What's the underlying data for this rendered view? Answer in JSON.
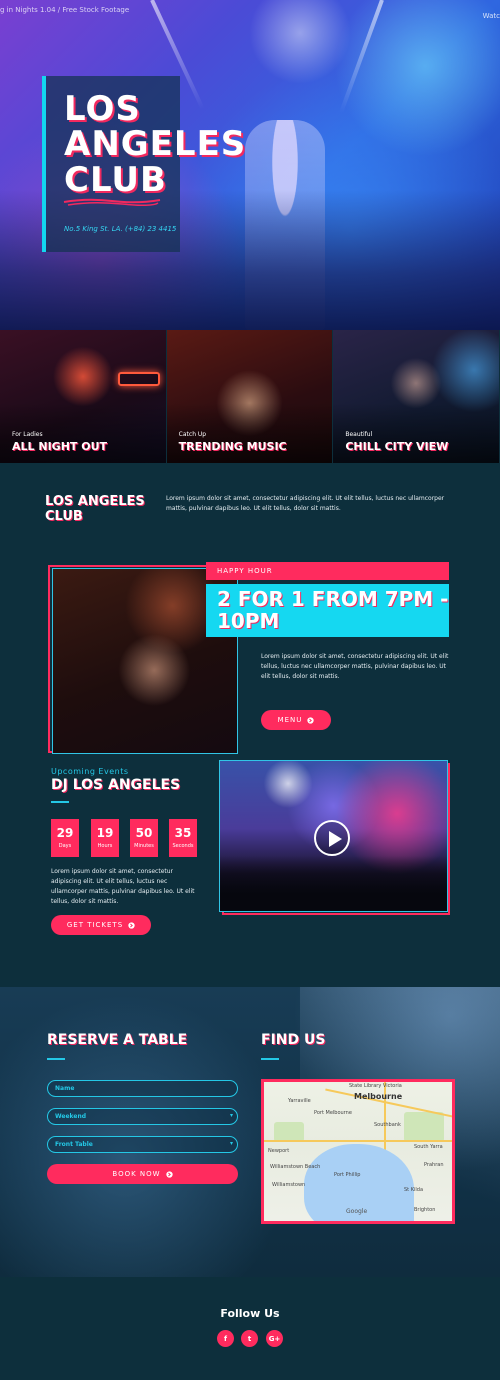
{
  "hero": {
    "caption": "g in Nights 1.04 / Free Stock Footage",
    "top_right": "Watc",
    "title": "LOS ANGELES CLUB",
    "address": "No.5 King St. LA. (+84) 23 4415"
  },
  "tiles": [
    {
      "kicker": "For Ladies",
      "name": "ALL NIGHT OUT"
    },
    {
      "kicker": "Catch Up",
      "name": "TRENDING MUSIC"
    },
    {
      "kicker": "Beautiful",
      "name": "CHILL CITY VIEW"
    }
  ],
  "intro": {
    "title": "LOS ANGELES CLUB",
    "text": "Lorem ipsum dolor sit amet, consectetur adipiscing elit. Ut elit tellus, luctus nec ullamcorper mattis, pulvinar dapibus leo. Ut elit tellus, dolor sit mattis."
  },
  "happy_hour": {
    "kicker": "HAPPY HOUR",
    "headline": "2 FOR 1 FROM 7PM - 10PM",
    "text": "Lorem ipsum dolor sit amet, consectetur adipiscing elit. Ut elit tellus, luctus nec ullamcorper mattis, pulvinar dapibus leo. Ut elit tellus, dolor sit mattis.",
    "button": "MENU"
  },
  "events": {
    "kicker": "Upcoming Events",
    "title": "DJ LOS ANGELES",
    "countdown": [
      {
        "value": "29",
        "label": "Days"
      },
      {
        "value": "19",
        "label": "Hours"
      },
      {
        "value": "50",
        "label": "Minutes"
      },
      {
        "value": "35",
        "label": "Seconds"
      }
    ],
    "text": "Lorem ipsum dolor sit amet, consectetur adipiscing elit. Ut elit tellus, luctus nec ullamcorper mattis, pulvinar dapibus leo. Ut elit tellus, dolor sit mattis.",
    "button": "GET TICKETS"
  },
  "reserve": {
    "title": "RESERVE A TABLE",
    "name_placeholder": "Name",
    "select1": "Weekend",
    "select2": "Front Table",
    "button": "BOOK NOW"
  },
  "find_us": {
    "title": "FIND US",
    "map_city": "Melbourne",
    "map_labels": [
      "State Library Victoria",
      "Yarraville",
      "Port Melbourne",
      "Southbank",
      "Williamstown",
      "Newport",
      "South Yarra",
      "Prahran",
      "St Kilda",
      "Brighton",
      "Williamstown Beach",
      "Port Phillip"
    ],
    "map_brand": "Google"
  },
  "footer": {
    "follow": "Follow Us",
    "social": [
      "f",
      "t",
      "G+"
    ]
  },
  "colors": {
    "accent": "#ff2b5e",
    "cyan": "#15d8f1",
    "bg": "#0d2f3c"
  }
}
